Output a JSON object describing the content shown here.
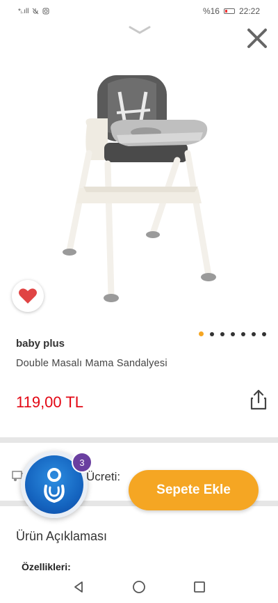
{
  "status_bar": {
    "left_indicators": "*ᵢ.ıll",
    "battery": "%16",
    "time": "22:22"
  },
  "product": {
    "brand": "baby plus",
    "name": "Double Masalı Mama Sandalyesi",
    "price": "119,00 TL",
    "image_count": 7,
    "active_image_index": 0
  },
  "shipping": {
    "label": "Ücreti:"
  },
  "assistant": {
    "badge_count": "3"
  },
  "actions": {
    "add_to_cart": "Sepete Ekle"
  },
  "description": {
    "title": "Ürün Açıklaması",
    "features_label": "Özellikleri:"
  },
  "colors": {
    "accent": "#f5a623",
    "price": "#e30613",
    "heart": "#e04444",
    "badge": "#6a3fa0"
  },
  "icons": [
    "chevron-down-icon",
    "close-icon",
    "heart-icon",
    "share-icon",
    "shipping-icon",
    "back-icon",
    "home-icon",
    "recents-icon"
  ]
}
